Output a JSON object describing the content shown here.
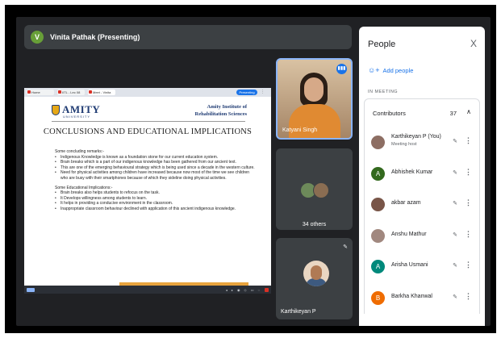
{
  "presenter": {
    "initial": "V",
    "label": "Vinita Pathak (Presenting)"
  },
  "browser": {
    "tabs": [
      "Home",
      "IITL - Lec 08",
      "Meet - Vinita"
    ],
    "pill": "Presenting"
  },
  "slide": {
    "logo": "AMITY",
    "logo_sub": "UNIVERSITY",
    "institute_line1": "Amity Institute of",
    "institute_line2": "Rehabilitation Sciences",
    "title": "CONCLUSIONS AND EDUCATIONAL IMPLICATIONS",
    "section1_head": "Some concluding remarks:-",
    "section1_bullets": [
      "Indigenous Knowledge is known as a foundation stone for our current education system.",
      "Brain breaks which is a part of our indigenous knowledge has been gathered from our ancient text.",
      "This are one of the emerging behavioural strategy which is being used since a decade in the western culture.",
      "Need for physical activities among children have increased because now most of the time we see children who are busy with their smartphones because of which they sideline doing physical activities."
    ],
    "section2_head": "Some Educational Implications:-",
    "section2_bullets": [
      "Brain breaks also helps students to refocus on the task.",
      "It Develops willingness among students to learn.",
      "It helps in providing a conducive environment in the classroom.",
      "Inappropriate classroom behaviour declined with application of this ancient indigenous knowledge."
    ]
  },
  "tiles": {
    "active_speaker": "Katyani Singh",
    "others_label": "34 others",
    "self_tile": "Karthikeyan P"
  },
  "people_panel": {
    "title": "People",
    "close": "X",
    "add_people": "Add people",
    "section_label": "IN MEETING",
    "group_label": "Contributors",
    "group_count": "37",
    "participants": [
      {
        "name": "Karthikeyan P (You)",
        "role": "Meeting host",
        "initial": "",
        "color": "#8d6e63"
      },
      {
        "name": "Abhishek Kumar",
        "role": "",
        "initial": "A",
        "color": "#33691e"
      },
      {
        "name": "akbar azam",
        "role": "",
        "initial": "",
        "color": "#795548"
      },
      {
        "name": "Anshu Mathur",
        "role": "",
        "initial": "",
        "color": "#a1887f"
      },
      {
        "name": "Arisha Usmani",
        "role": "",
        "initial": "A",
        "color": "#00897b"
      },
      {
        "name": "Barkha Khanwal",
        "role": "",
        "initial": "B",
        "color": "#ef6c00"
      }
    ]
  }
}
